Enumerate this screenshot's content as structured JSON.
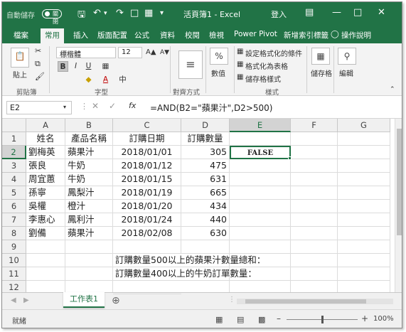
{
  "titlebar": {
    "autosave_label": "自動儲存",
    "autosave_state": "關閉",
    "title": "活頁簿1  -  Excel",
    "login_label": "登入",
    "accent": "#217346"
  },
  "tabs": [
    "檔案",
    "常用",
    "插入",
    "版面配置",
    "公式",
    "資料",
    "校閱",
    "檢視",
    "Power Pivot",
    "新增索引標籤",
    "操作說明"
  ],
  "active_tab": "常用",
  "ribbon": {
    "paste_label": "貼上",
    "clipboard_group": "剪貼簿",
    "font_name": "標楷體",
    "font_size": "12",
    "font_group": "字型",
    "align_group": "對齊方式",
    "number_label": "數值",
    "number_symbol": "%",
    "cond_format": "設定格式化的條件",
    "format_table": "格式化為表格",
    "cell_styles": "儲存格樣式",
    "styles_group": "樣式",
    "cells_label": "儲存格",
    "edit_label": "編輯",
    "bold": "B",
    "italic": "I",
    "underline": "U",
    "font_color_letter": "A"
  },
  "formula_bar": {
    "name_box": "E2",
    "fx": "fx",
    "formula": "=AND(B2=\"蘋果汁\",D2>500)"
  },
  "grid": {
    "columns": [
      "A",
      "B",
      "C",
      "D",
      "E",
      "F",
      "G"
    ],
    "rows": [
      [
        "姓名",
        "產品名稱",
        "訂購日期",
        "訂購數量",
        "",
        "",
        ""
      ],
      [
        "劉梅英",
        "蘋果汁",
        "2018/01/01",
        "305",
        "FALSE",
        "",
        ""
      ],
      [
        "張良",
        "牛奶",
        "2018/01/12",
        "475",
        "",
        "",
        ""
      ],
      [
        "周宜蕙",
        "牛奶",
        "2018/01/15",
        "631",
        "",
        "",
        ""
      ],
      [
        "孫寧",
        "鳳梨汁",
        "2018/01/19",
        "665",
        "",
        "",
        ""
      ],
      [
        "吳權",
        "橙汁",
        "2018/01/20",
        "434",
        "",
        "",
        ""
      ],
      [
        "李惠心",
        "鳳利汁",
        "2018/01/24",
        "440",
        "",
        "",
        ""
      ],
      [
        "劉備",
        "蘋果汁",
        "2018/02/08",
        "630",
        "",
        "",
        ""
      ],
      [
        "",
        "",
        "",
        "",
        "",
        "",
        ""
      ],
      [
        "",
        "",
        "訂購數量500以上的蘋果汁數量總和：",
        "",
        "",
        "",
        ""
      ],
      [
        "",
        "",
        "訂購數量400以上的牛奶訂單數量：",
        "",
        "",
        "",
        ""
      ],
      [
        "",
        "",
        "",
        "",
        "",
        "",
        ""
      ]
    ],
    "selected": "E2"
  },
  "sheet_tab": "工作表1",
  "status": {
    "ready": "就緒",
    "zoom": "100%"
  }
}
